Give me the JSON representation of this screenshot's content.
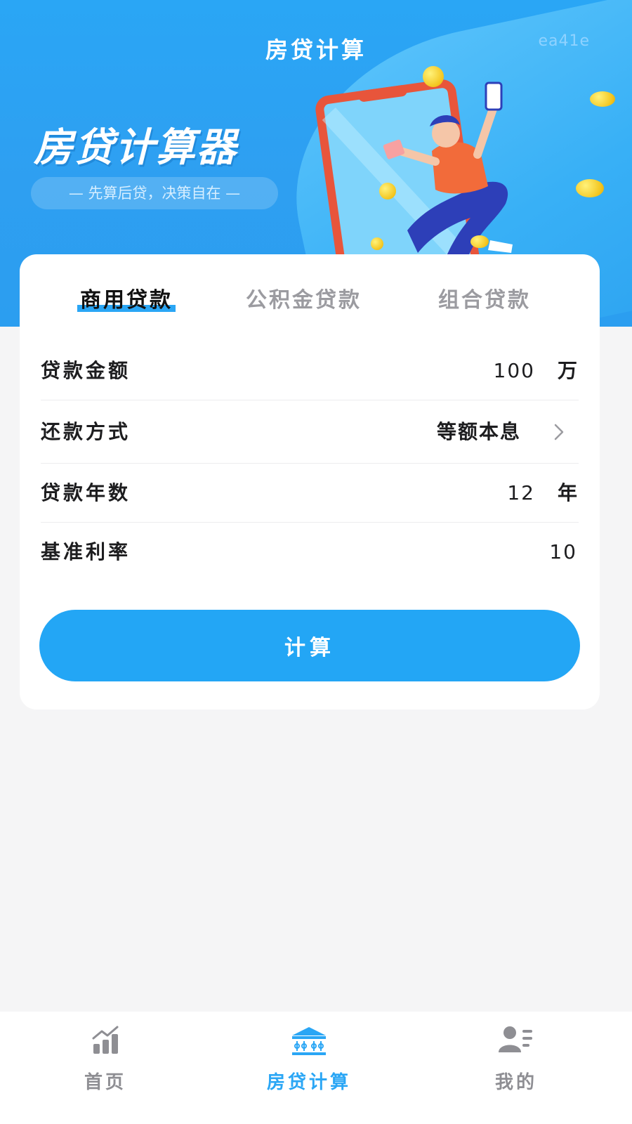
{
  "header": {
    "title": "房贷计算",
    "watermark": "ea41e"
  },
  "hero": {
    "title": "房贷计算器",
    "subtitle": "— 先算后贷，决策自在 —"
  },
  "tabs": [
    {
      "label": "商用贷款",
      "active": true
    },
    {
      "label": "公积金贷款",
      "active": false
    },
    {
      "label": "组合贷款",
      "active": false
    }
  ],
  "form": {
    "loan_amount": {
      "label": "贷款金额",
      "value": "100",
      "unit": "万"
    },
    "repayment_method": {
      "label": "还款方式",
      "value": "等额本息"
    },
    "loan_years": {
      "label": "贷款年数",
      "value": "12",
      "unit": "年"
    },
    "base_rate": {
      "label": "基准利率",
      "value": "10"
    }
  },
  "calculate_button": "计算",
  "bottom_nav": [
    {
      "label": "首页",
      "icon": "chart-icon",
      "active": false
    },
    {
      "label": "房贷计算",
      "icon": "bank-icon",
      "active": true
    },
    {
      "label": "我的",
      "icon": "user-list-icon",
      "active": false
    }
  ],
  "colors": {
    "primary": "#2aa6f5",
    "background": "#f5f5f6",
    "text": "#1d1d1f",
    "inactive": "#8e8e93"
  }
}
